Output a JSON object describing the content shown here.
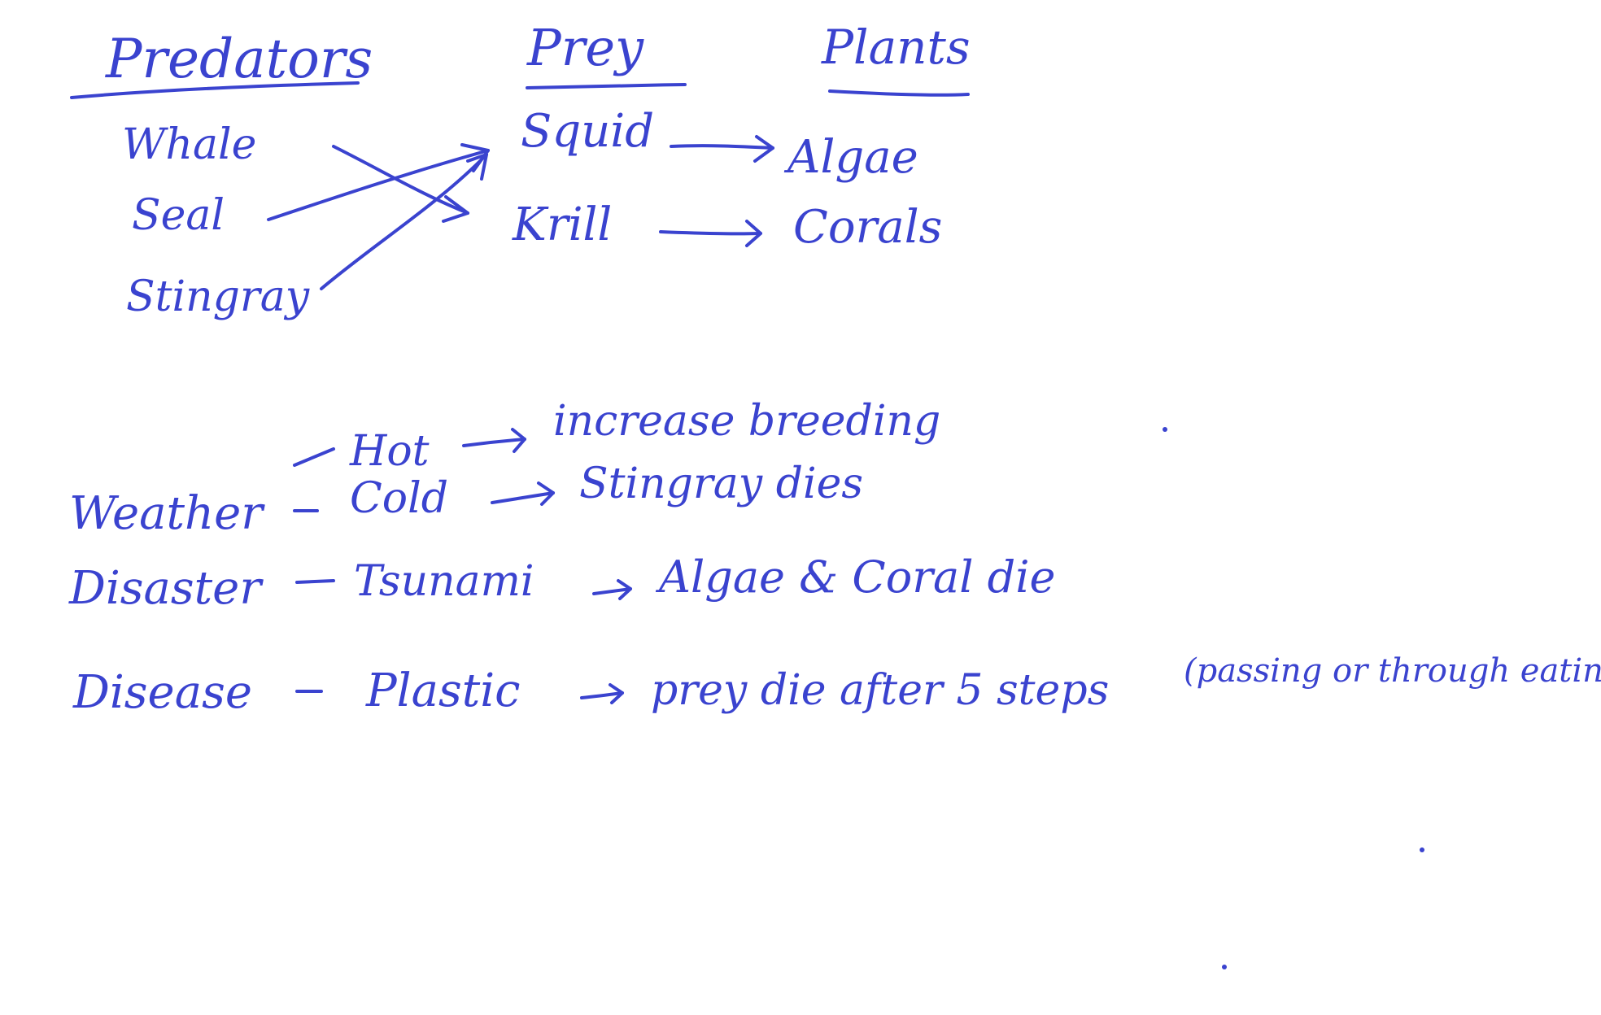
{
  "ink_color": "#3a43cf",
  "background_color": "#ffffff",
  "headings": {
    "predators": "Predators",
    "prey": "Prey",
    "plants": "Plants"
  },
  "predators": [
    "Whale",
    "Seal",
    "Stingray"
  ],
  "prey": [
    "Squid",
    "Krill"
  ],
  "plants": [
    "Algae",
    "Corals"
  ],
  "events": {
    "hot_label": "Hot",
    "hot_effect": "increase breeding",
    "weather_label": "Weather",
    "cold_label": "Cold",
    "cold_effect": "Stingray dies",
    "disaster_label": "Disaster",
    "tsunami_label": "Tsunami",
    "tsunami_effect": "Algae & Coral die",
    "disease_label": "Disease",
    "plastic_label": "Plastic",
    "plastic_effect": "prey die after 5 steps",
    "plastic_note": "(passing or through eating)"
  }
}
